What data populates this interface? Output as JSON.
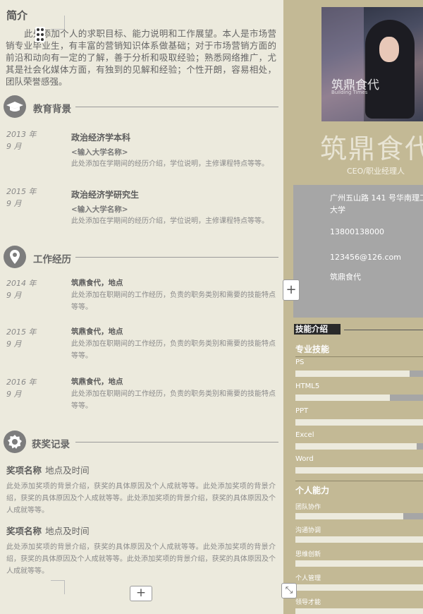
{
  "intro": {
    "heading": "简介",
    "text": "此处添加个人的求职目标、能力说明和工作展望。本人是市场营销专业毕业生，有丰富的营销知识体系做基础；对于市场营销方面的前沿和动向有一定的了解，善于分析和吸取经验；熟悉网络推广，尤其是社会化媒体方面，有独到的见解和经验；个性开朗，容易相处，团队荣誉感强。"
  },
  "education": {
    "heading": "教育背景",
    "icon": "graduation-cap-icon",
    "items": [
      {
        "year": "2013 年",
        "month": "9 月",
        "title": "政治经济学本科",
        "school": "<输入大学名称>",
        "desc": "此处添加在学期间的经历介绍，学位说明，主修课程特点等等。"
      },
      {
        "year": "2015 年",
        "month": "9 月",
        "title": "政治经济学研究生",
        "school": "<输入大学名称>",
        "desc": "此处添加在学期间的经历介绍，学位说明，主修课程特点等等。"
      }
    ]
  },
  "work": {
    "heading": "工作经历",
    "icon": "map-pin-icon",
    "items": [
      {
        "year": "2014 年",
        "month": "9 月",
        "title": "筑鼎食代，地点",
        "desc": "此处添加在职期间的工作经历，负责的职务类别和需要的技能特点等等。"
      },
      {
        "year": "2015 年",
        "month": "9 月",
        "title": "筑鼎食代，地点",
        "desc": "此处添加在职期间的工作经历，负责的职务类别和需要的技能特点等等。"
      },
      {
        "year": "2016 年",
        "month": "9 月",
        "title": "筑鼎食代，地点",
        "desc": "此处添加在职期间的工作经历，负责的职务类别和需要的技能特点等等。"
      }
    ]
  },
  "awards": {
    "heading": "获奖记录",
    "icon": "badge-icon",
    "items": [
      {
        "name": "奖项名称",
        "place": "地点及时间",
        "desc": "此处添加奖项的背景介绍，获奖的具体原因及个人成就等等。此处添加奖项的背景介绍，获奖的具体原因及个人成就等等。此处添加奖项的背景介绍，获奖的具体原因及个人成就等等。"
      },
      {
        "name": "奖项名称",
        "place": "地点及时间",
        "desc": "此处添加奖项的背景介绍，获奖的具体原因及个人成就等等。此处添加奖项的背景介绍，获奖的具体原因及个人成就等等。此处添加奖项的背景介绍，获奖的具体原因及个人成就等等。"
      }
    ]
  },
  "profile": {
    "photo_logo": "筑鼎食代",
    "photo_logo_sub": "Building Times",
    "name": "筑鼎食代",
    "role": "CEO/职业经理人",
    "address": "广州五山路 141 号华南理工大学",
    "phone": "13800138000",
    "email": "123456@126.com",
    "company": "筑鼎食代"
  },
  "skills": {
    "heading": "技能介绍",
    "professional_heading": "专业技能",
    "professional": [
      {
        "name": "PS",
        "level": 0.85
      },
      {
        "name": "HTML5",
        "level": 0.7
      },
      {
        "name": "PPT",
        "level": 1.0
      },
      {
        "name": "Excel",
        "level": 0.9
      },
      {
        "name": "Word",
        "level": 1.0
      }
    ],
    "personal_heading": "个人能力",
    "personal": [
      {
        "name": "团队协作",
        "level": 0.8
      },
      {
        "name": "沟通协调",
        "level": 1.0
      },
      {
        "name": "思维创新",
        "level": 1.0
      },
      {
        "name": "个人管理",
        "level": 1.0
      },
      {
        "name": "领导才能",
        "level": 1.0
      }
    ]
  },
  "controls": {
    "plus": "+",
    "resize": "⤡"
  },
  "colors": {
    "left_bg": "#eceadd",
    "right_bg": "#c3b995",
    "contact_bg": "#a6a6a6",
    "bar_fill": "#eceadd",
    "bar_track": "#a6a6a6"
  }
}
